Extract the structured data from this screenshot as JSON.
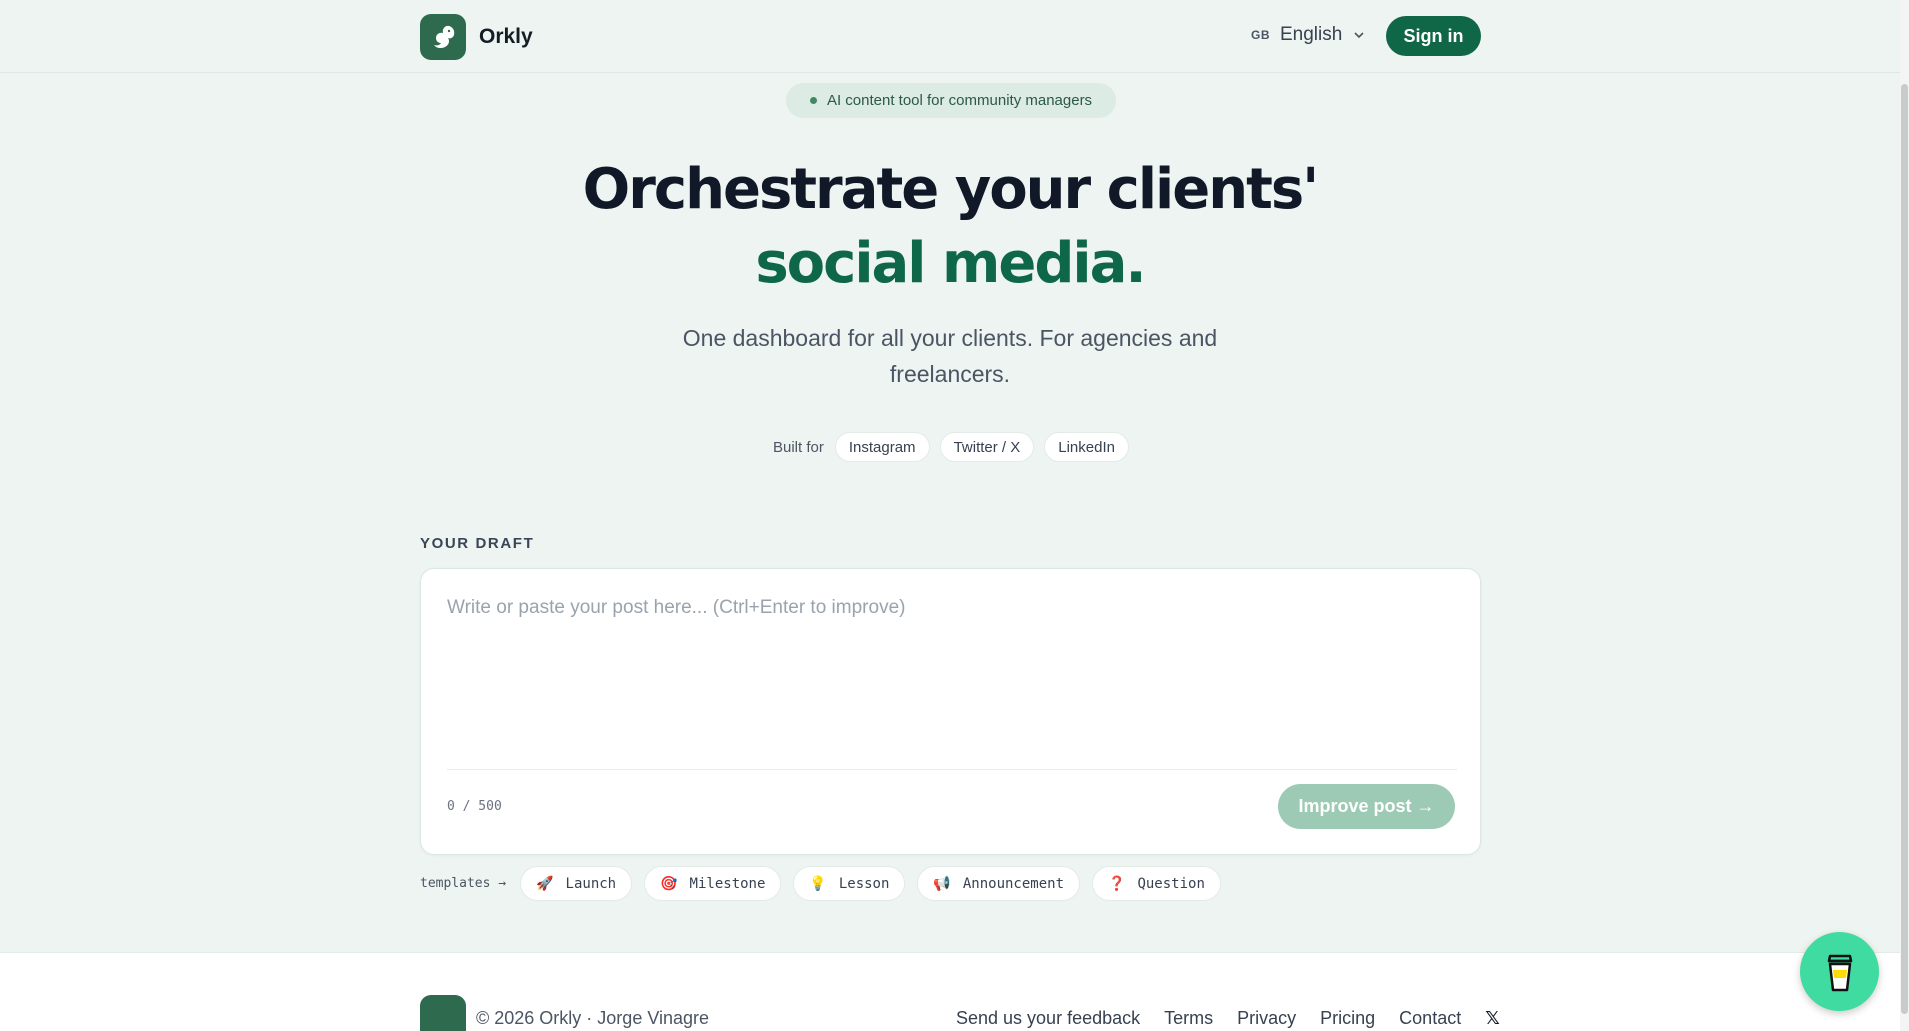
{
  "header": {
    "brand_name": "Orkly",
    "language_flag": "GB",
    "language_label": "English",
    "signin_label": "Sign in"
  },
  "hero": {
    "pill_text": "AI content tool for community managers",
    "title_line1": "Orchestrate your clients'",
    "title_line2": "social media.",
    "subtitle": "One dashboard for all your clients. For agencies and freelancers.",
    "built_for_label": "Built for",
    "platforms": [
      "Instagram",
      "Twitter / X",
      "LinkedIn"
    ]
  },
  "draft": {
    "section_label": "YOUR DRAFT",
    "placeholder": "Write or paste your post here... (Ctrl+Enter to improve)",
    "value": "",
    "counter": "0 / 500",
    "improve_label": "Improve post →"
  },
  "templates": {
    "label": "templates →",
    "items": [
      {
        "icon": "🚀",
        "label": "Launch"
      },
      {
        "icon": "🎯",
        "label": "Milestone"
      },
      {
        "icon": "💡",
        "label": "Lesson"
      },
      {
        "icon": "📢",
        "label": "Announcement"
      },
      {
        "icon": "❓",
        "label": "Question"
      }
    ]
  },
  "footer": {
    "copyright": "© 2026 Orkly · Jorge Vinagre",
    "links": [
      "Send us your feedback",
      "Terms",
      "Privacy",
      "Pricing",
      "Contact"
    ],
    "x_link": "𝕏"
  },
  "colors": {
    "accent": "#0f6747",
    "background": "#eef4f1",
    "button_disabled": "#9ccab5",
    "coffee": "#40dba0"
  }
}
